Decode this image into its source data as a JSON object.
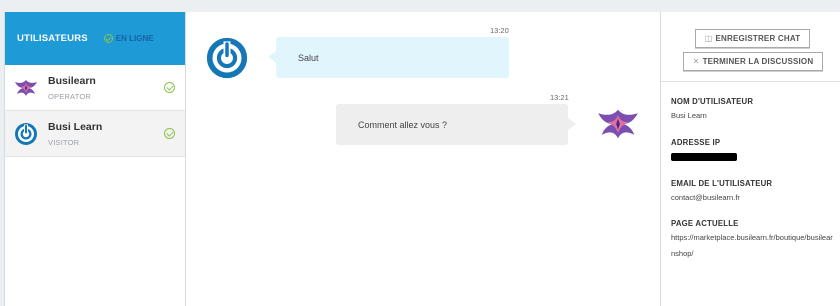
{
  "sidebar": {
    "title": "UTILISATEURS",
    "online_label": "EN LIGNE",
    "users": [
      {
        "name": "Busilearn",
        "role": "OPERATOR",
        "avatar": "phoenix-logo-icon",
        "status": "online"
      },
      {
        "name": "Busi Learn",
        "role": "VISITOR",
        "avatar": "power-icon",
        "status": "online"
      }
    ]
  },
  "chat": {
    "messages": [
      {
        "direction": "incoming",
        "time": "13:20",
        "text": "Salut",
        "avatar": "power-icon"
      },
      {
        "direction": "outgoing",
        "time": "13:21",
        "text": "Comment allez vous ?",
        "avatar": "phoenix-logo-icon"
      }
    ]
  },
  "details": {
    "save_label": "ENREGISTRER CHAT",
    "end_label": "TERMINER LA DISCUSSION",
    "username_label": "NOM D'UTILISATEUR",
    "username_value": "Busi Learn",
    "ip_label": "ADRESSE IP",
    "ip_value": "",
    "email_label": "EMAIL DE L'UTILISATEUR",
    "email_value": "contact@busilearn.fr",
    "page_label": "PAGE ACTUELLE",
    "page_value": "https://marketplace.busilearn.fr/boutique/busilearnshop/"
  },
  "colors": {
    "header_blue": "#1e9ad6",
    "online_green": "#8bc34a",
    "incoming_bubble": "#e1f5fd",
    "outgoing_bubble": "#eeeeee",
    "power_icon_blue": "#1677b6"
  }
}
